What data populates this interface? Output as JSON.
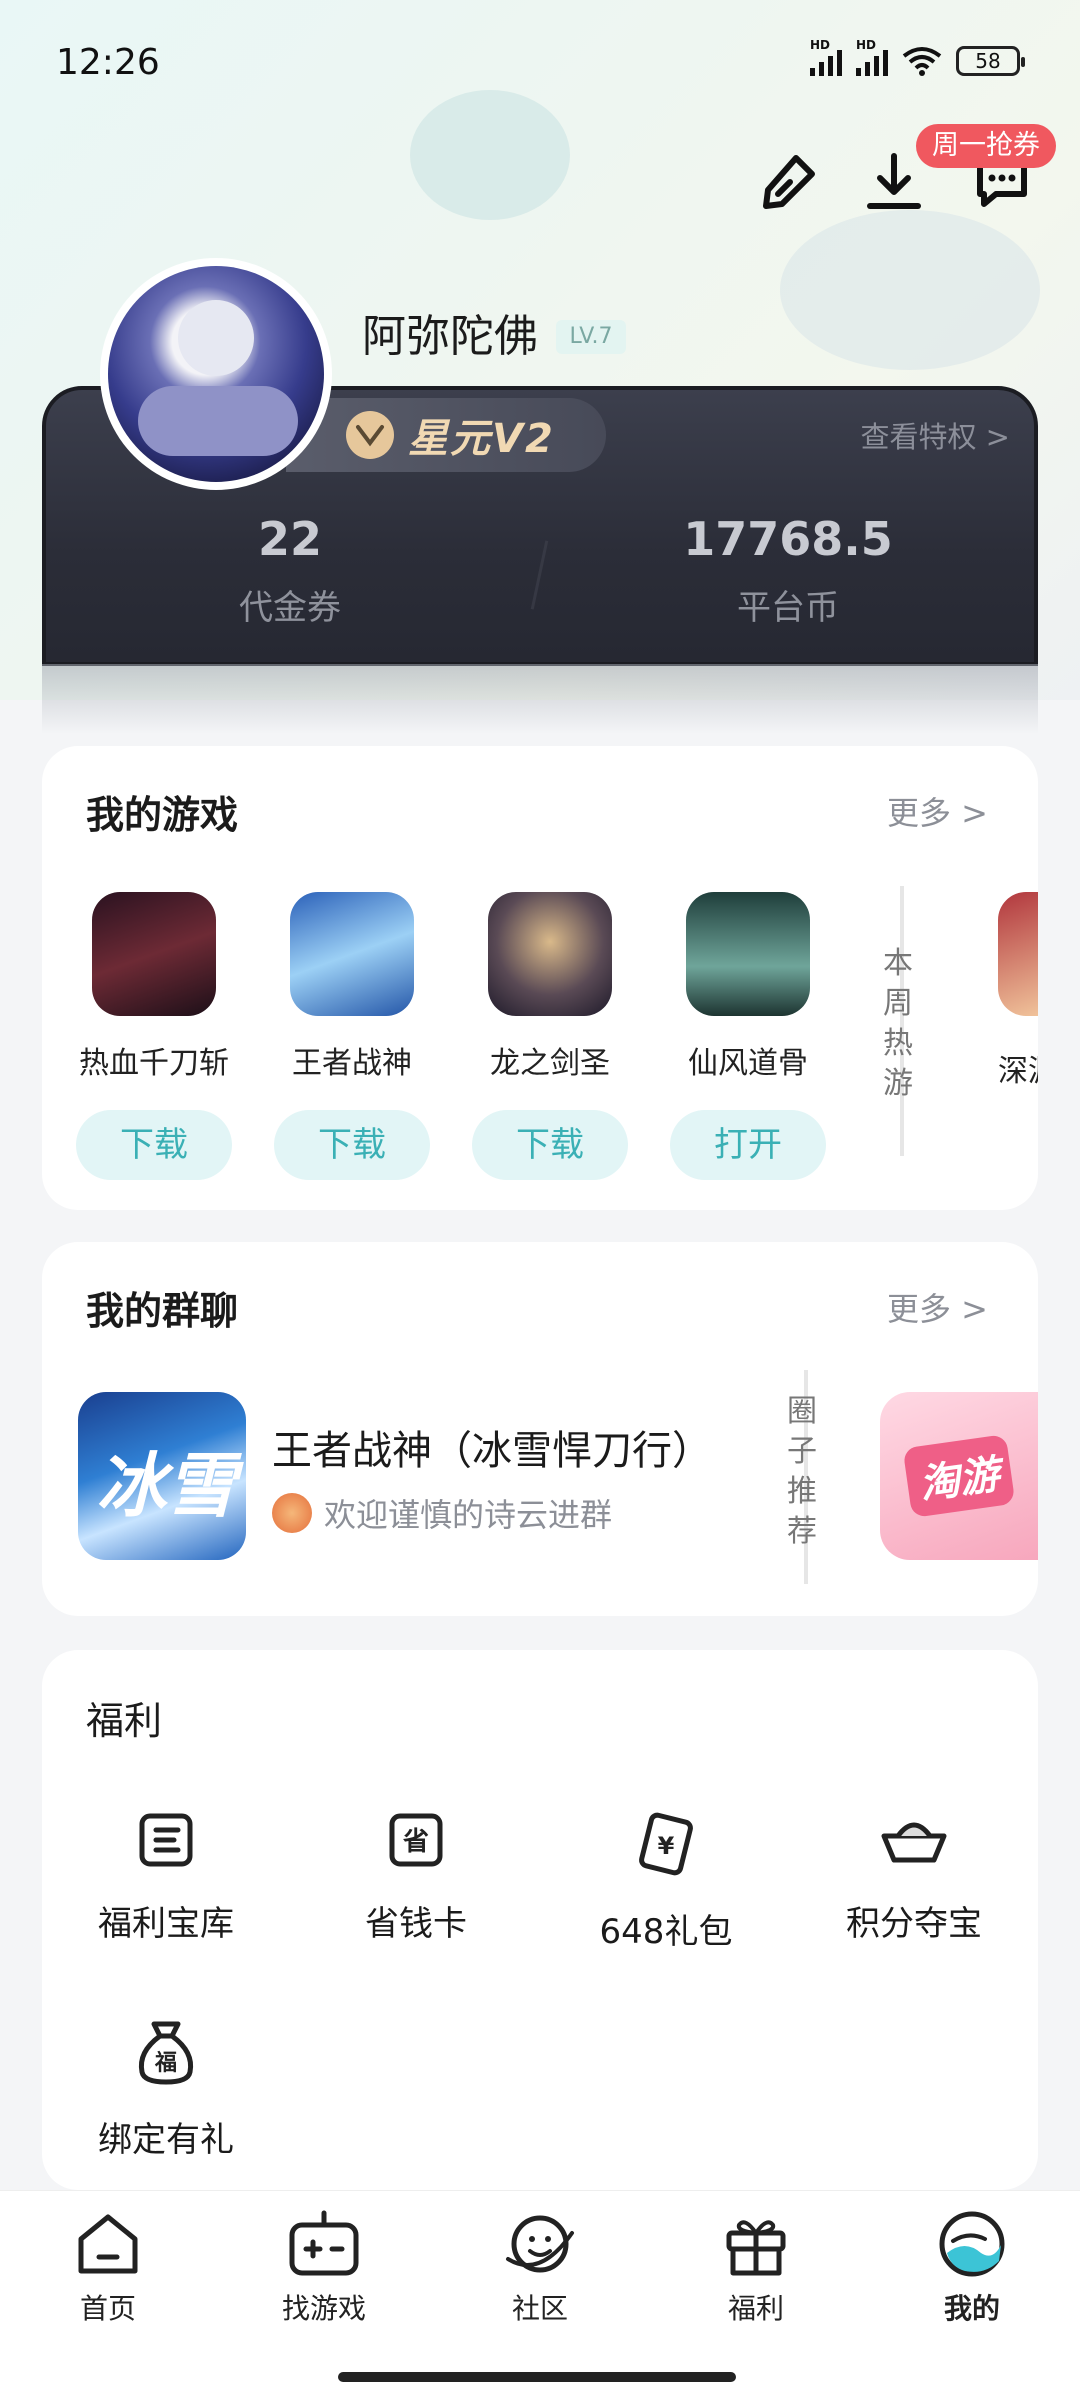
{
  "status_bar": {
    "time": "12:26",
    "battery": "58"
  },
  "header": {
    "promo_badge": "周一抢券"
  },
  "profile": {
    "username": "阿弥陀佛",
    "level": "LV.7"
  },
  "vip": {
    "title": "星元V2",
    "privilege_link": "查看特权 >",
    "coupons": {
      "value": "22",
      "label": "代金券"
    },
    "coins": {
      "value": "17768.5",
      "label": "平台币"
    }
  },
  "my_games": {
    "title": "我的游戏",
    "more": "更多 >",
    "games": [
      {
        "name": "热血千刀斩",
        "button": "下载",
        "color": "#3a2030"
      },
      {
        "name": "王者战神",
        "button": "下载",
        "color": "#5c9fd8"
      },
      {
        "name": "龙之剑圣",
        "button": "下载",
        "color": "#4a3f45"
      },
      {
        "name": "仙风道骨",
        "button": "打开",
        "color": "#2f5a55"
      }
    ],
    "side_label": "本周热游",
    "partial_game": "深渊"
  },
  "my_groups": {
    "title": "我的群聊",
    "more": "更多 >",
    "group": {
      "icon_text": "冰雪",
      "name": "王者战神（冰雪悍刀行）",
      "message": "欢迎谨慎的诗云进群"
    },
    "side_label": "圈子推荐",
    "recommend_icon": "淘游"
  },
  "welfare": {
    "title": "福利",
    "items": [
      {
        "label": "福利宝库",
        "icon": "treasury-icon"
      },
      {
        "label": "省钱卡",
        "icon": "saving-card-icon"
      },
      {
        "label": "648礼包",
        "icon": "gift-pack-icon"
      },
      {
        "label": "积分夺宝",
        "icon": "ingot-icon"
      },
      {
        "label": "绑定有礼",
        "icon": "money-bag-icon"
      }
    ]
  },
  "bottom_nav": [
    {
      "label": "首页"
    },
    {
      "label": "找游戏"
    },
    {
      "label": "社区"
    },
    {
      "label": "福利"
    },
    {
      "label": "我的"
    }
  ]
}
